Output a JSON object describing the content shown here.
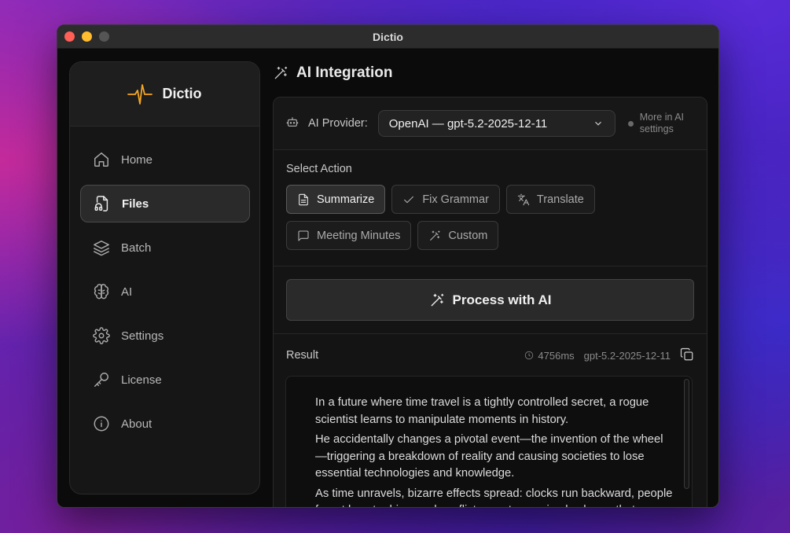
{
  "window": {
    "title": "Dictio"
  },
  "brand": {
    "name": "Dictio",
    "accent": "#f5a623"
  },
  "sidebar": {
    "items": [
      {
        "label": "Home",
        "icon": "home-icon",
        "active": false
      },
      {
        "label": "Files",
        "icon": "file-audio-icon",
        "active": true
      },
      {
        "label": "Batch",
        "icon": "layers-icon",
        "active": false
      },
      {
        "label": "AI",
        "icon": "brain-icon",
        "active": false
      },
      {
        "label": "Settings",
        "icon": "gear-icon",
        "active": false
      },
      {
        "label": "License",
        "icon": "key-icon",
        "active": false
      },
      {
        "label": "About",
        "icon": "info-icon",
        "active": false
      }
    ]
  },
  "page": {
    "title": "AI Integration",
    "icon": "magic-wand-icon"
  },
  "provider": {
    "label": "AI Provider:",
    "selected": "OpenAI — gpt-5.2-2025-12-11",
    "more_note": "More in AI settings"
  },
  "actions": {
    "label": "Select Action",
    "chips": [
      {
        "label": "Summarize",
        "icon": "document-icon",
        "active": true
      },
      {
        "label": "Fix Grammar",
        "icon": "check-icon",
        "active": false
      },
      {
        "label": "Translate",
        "icon": "translate-icon",
        "active": false
      },
      {
        "label": "Meeting Minutes",
        "icon": "chat-icon",
        "active": false
      },
      {
        "label": "Custom",
        "icon": "magic-wand-icon",
        "active": false
      }
    ]
  },
  "process_button": {
    "label": "Process with AI"
  },
  "result": {
    "label": "Result",
    "duration": "4756ms",
    "model": "gpt-5.2-2025-12-11",
    "paragraphs": [
      "In a future where time travel is a tightly controlled secret, a rogue scientist learns to manipulate moments in history.",
      "He accidentally changes a pivotal event—the invention of the wheel—triggering a breakdown of reality and causing societies to lose essential technologies and knowledge.",
      "As time unravels, bizarre effects spread: clocks run backward, people forget how to drive, and conflicts erupt over simple chores that"
    ]
  }
}
